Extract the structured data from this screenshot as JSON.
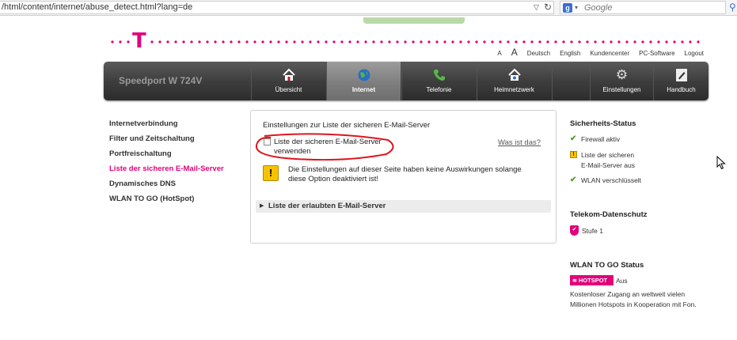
{
  "browser": {
    "url": "/html/content/internet/abuse_detect.html?lang=de",
    "search_engine_letter": "g",
    "search_placeholder": "Google"
  },
  "header": {
    "logo": "T",
    "top_links": [
      "A",
      "A",
      "Deutsch",
      "English",
      "Kundencenter",
      "PC-Software",
      "Logout"
    ]
  },
  "nav": {
    "router_name": "Speedport W 724V",
    "items": [
      {
        "label": "Übersicht",
        "icon": "home-icon"
      },
      {
        "label": "Internet",
        "icon": "globe-icon"
      },
      {
        "label": "Telefonie",
        "icon": "phone-icon"
      },
      {
        "label": "Heimnetzwerk",
        "icon": "home-network-icon"
      },
      {
        "label": "Einstellungen",
        "icon": "gear-icon"
      },
      {
        "label": "Handbuch",
        "icon": "manual-icon"
      }
    ],
    "active_index": 1
  },
  "sidebar": {
    "items": [
      {
        "label": "Internetverbindung"
      },
      {
        "label": "Filter und Zeitschaltung"
      },
      {
        "label": "Portfreischaltung"
      },
      {
        "label": "Liste der sicheren E-Mail-Server"
      },
      {
        "label": "Dynamisches DNS"
      },
      {
        "label": "WLAN TO GO (HotSpot)"
      }
    ]
  },
  "content": {
    "title": "Einstellungen zur Liste der sicheren E-Mail-Server",
    "checkbox_label": "Liste der sicheren E-Mail-Server verwenden",
    "checkbox_checked": false,
    "help_link": "Was ist das?",
    "warning": "Die Einstellungen auf dieser Seite haben keine Auswirkungen solange diese Option deaktiviert ist!",
    "accordion_label": "Liste der erlaubten E-Mail-Server"
  },
  "status": {
    "heading": "Sicherheits-Status",
    "items": [
      {
        "text": "Firewall aktiv",
        "state": "ok"
      },
      {
        "text": "Liste der sicheren",
        "text2": "E-Mail-Server aus",
        "state": "warning"
      },
      {
        "text": "WLAN verschlüsselt",
        "state": "ok"
      }
    ],
    "privacy_heading": "Telekom-Datenschutz",
    "privacy_level": "Stufe 1",
    "wlan_heading": "WLAN TO GO Status",
    "hotspot_badge": "HOTSPOT",
    "hotspot_state": "Aus",
    "hotspot_desc1": "Kostenloser Zugang an weltweit vielen",
    "hotspot_desc2": "Millionen Hotspots in Kooperation mit Fon."
  },
  "colors": {
    "brand": "#e2007a",
    "annotation": "#e0141e"
  }
}
